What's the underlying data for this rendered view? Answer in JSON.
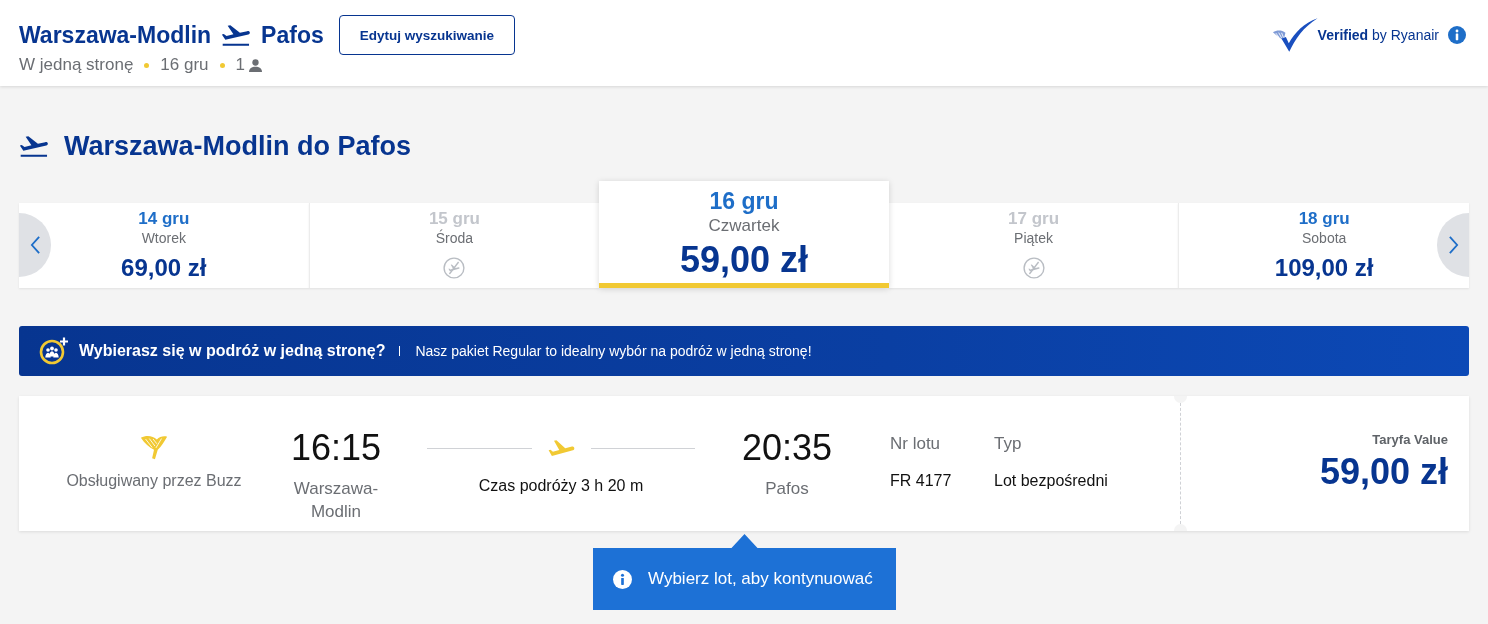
{
  "header": {
    "origin": "Warszawa-Modlin",
    "destination": "Pafos",
    "trip_type": "W jedną stronę",
    "date": "16 gru",
    "passengers": "1",
    "edit_button": "Edytuj wyszukiwanie",
    "verified": "**Verified** by Ryanair"
  },
  "route_heading": "Warszawa-Modlin do Pafos",
  "date_carousel": {
    "days": [
      {
        "date": "14 gru",
        "weekday": "Wtorek",
        "price": "69,00 zł",
        "disabled": false,
        "selected": false
      },
      {
        "date": "15 gru",
        "weekday": "Środa",
        "disabled": true,
        "selected": false
      },
      {
        "date": "16 gru",
        "weekday": "Czwartek",
        "price": "59,00 zł",
        "disabled": false,
        "selected": true
      },
      {
        "date": "17 gru",
        "weekday": "Piątek",
        "disabled": true,
        "selected": false
      },
      {
        "date": "18 gru",
        "weekday": "Sobota",
        "price": "109,00 zł",
        "disabled": false,
        "selected": false
      }
    ]
  },
  "banner": {
    "title": "Wybierasz się w podróż w jedną stronę?",
    "text": "Nasz pakiet Regular to idealny wybór na podróż w jedną stronę!"
  },
  "flight": {
    "operator": "Obsługiwany przez Buzz",
    "departure_time": "16:15",
    "departure_airport": "Warszawa-Modlin",
    "duration": "Czas podróży 3 h 20 m",
    "arrival_time": "20:35",
    "arrival_airport": "Pafos",
    "flight_number_label": "Nr lotu",
    "flight_number": "FR 4177",
    "type_label": "Typ",
    "type": "Lot bezpośredni",
    "fare_label": "Taryfa Value",
    "fare_price": "59,00 zł"
  },
  "tooltip": {
    "text": "Wybierz lot, aby kontynuować"
  }
}
